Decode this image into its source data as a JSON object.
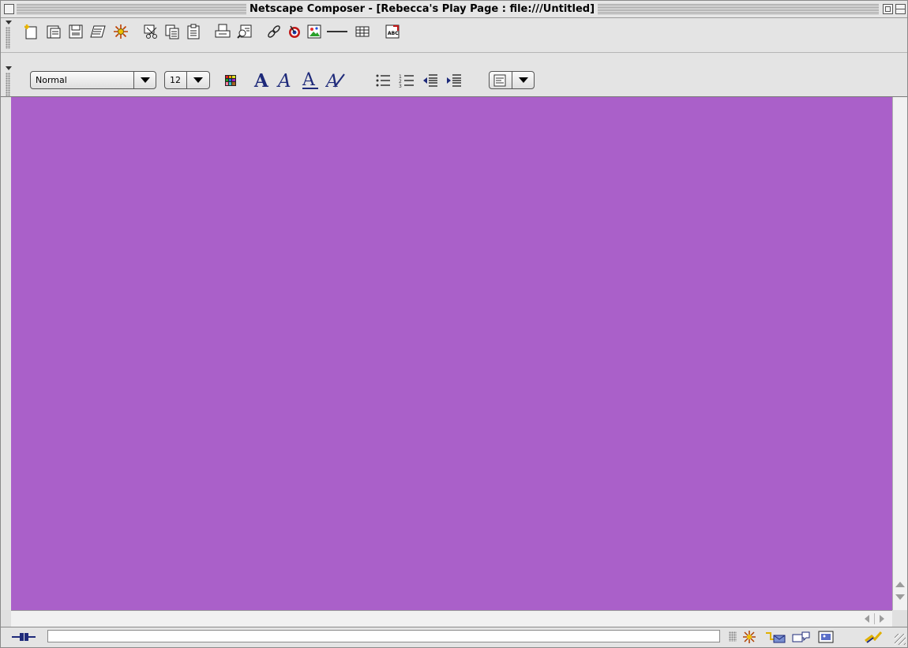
{
  "window": {
    "title": "Netscape Composer - [Rebecca's Play Page : file:///Untitled]"
  },
  "composition_toolbar": {
    "buttons": [
      {
        "name": "new-page",
        "icon": "new-page-icon"
      },
      {
        "name": "open",
        "icon": "open-file-icon"
      },
      {
        "name": "save",
        "icon": "save-disk-icon"
      },
      {
        "name": "publish",
        "icon": "publish-icon"
      },
      {
        "name": "preview",
        "icon": "preview-sparkle-icon"
      },
      {
        "name": "cut",
        "icon": "scissors-icon"
      },
      {
        "name": "copy",
        "icon": "copy-icon"
      },
      {
        "name": "paste",
        "icon": "paste-icon"
      },
      {
        "name": "print",
        "icon": "printer-icon"
      },
      {
        "name": "find",
        "icon": "find-icon"
      },
      {
        "name": "link",
        "icon": "link-icon"
      },
      {
        "name": "target",
        "icon": "target-icon"
      },
      {
        "name": "image",
        "icon": "insert-image-icon"
      },
      {
        "name": "horizontal-line",
        "icon": "horizontal-line-icon"
      },
      {
        "name": "table",
        "icon": "table-icon"
      },
      {
        "name": "spelling",
        "icon": "spell-check-icon"
      }
    ]
  },
  "formatting_toolbar": {
    "paragraph_style": "Normal",
    "font_size": "12",
    "buttons": [
      {
        "name": "text-color",
        "icon": "color-grid-icon"
      },
      {
        "name": "bold",
        "icon": "bold-icon"
      },
      {
        "name": "italic",
        "icon": "italic-icon"
      },
      {
        "name": "underline",
        "icon": "underline-icon"
      },
      {
        "name": "clear-styles",
        "icon": "clear-styles-icon"
      },
      {
        "name": "bullet-list",
        "icon": "bullet-list-icon"
      },
      {
        "name": "numbered-list",
        "icon": "numbered-list-icon"
      },
      {
        "name": "outdent",
        "icon": "outdent-icon"
      },
      {
        "name": "indent",
        "icon": "indent-icon"
      },
      {
        "name": "alignment",
        "icon": "align-left-icon"
      }
    ]
  },
  "document": {
    "background_color": "#aa60c9"
  },
  "status_bar": {
    "status_text": "",
    "component_icons": [
      "navigator-icon",
      "mail-icon",
      "discussions-icon",
      "composer-icon",
      "security-icon"
    ]
  }
}
